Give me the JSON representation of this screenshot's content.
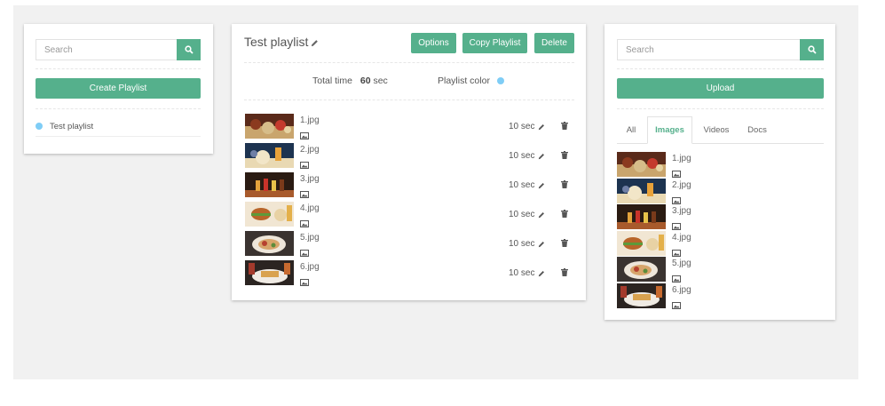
{
  "left": {
    "search_placeholder": "Search",
    "create_label": "Create Playlist",
    "playlists": [
      {
        "name": "Test playlist",
        "color": "#7fcdf6"
      }
    ]
  },
  "center": {
    "title": "Test playlist",
    "options_label": "Options",
    "copy_label": "Copy Playlist",
    "delete_label": "Delete",
    "total_time_label": "Total time",
    "total_time_value": "60",
    "total_time_unit": "sec",
    "playlist_color_label": "Playlist color",
    "playlist_color": "#7fcdf6",
    "items": [
      {
        "name": "1.jpg",
        "duration": "10 sec"
      },
      {
        "name": "2.jpg",
        "duration": "10 sec"
      },
      {
        "name": "3.jpg",
        "duration": "10 sec"
      },
      {
        "name": "4.jpg",
        "duration": "10 sec"
      },
      {
        "name": "5.jpg",
        "duration": "10 sec"
      },
      {
        "name": "6.jpg",
        "duration": "10 sec"
      }
    ]
  },
  "right": {
    "search_placeholder": "Search",
    "upload_label": "Upload",
    "tabs": [
      {
        "label": "All",
        "active": false
      },
      {
        "label": "Images",
        "active": true
      },
      {
        "label": "Videos",
        "active": false
      },
      {
        "label": "Docs",
        "active": false
      }
    ],
    "files": [
      {
        "name": "1.jpg"
      },
      {
        "name": "2.jpg"
      },
      {
        "name": "3.jpg"
      },
      {
        "name": "4.jpg"
      },
      {
        "name": "5.jpg"
      },
      {
        "name": "6.jpg"
      }
    ]
  },
  "colors": {
    "accent": "#55b08c",
    "background": "#f1f1f1",
    "dot": "#7fcdf6",
    "active_tab": "#55b08c"
  },
  "icons": [
    "search-icon",
    "pencil-icon",
    "image-icon",
    "trash-icon"
  ]
}
